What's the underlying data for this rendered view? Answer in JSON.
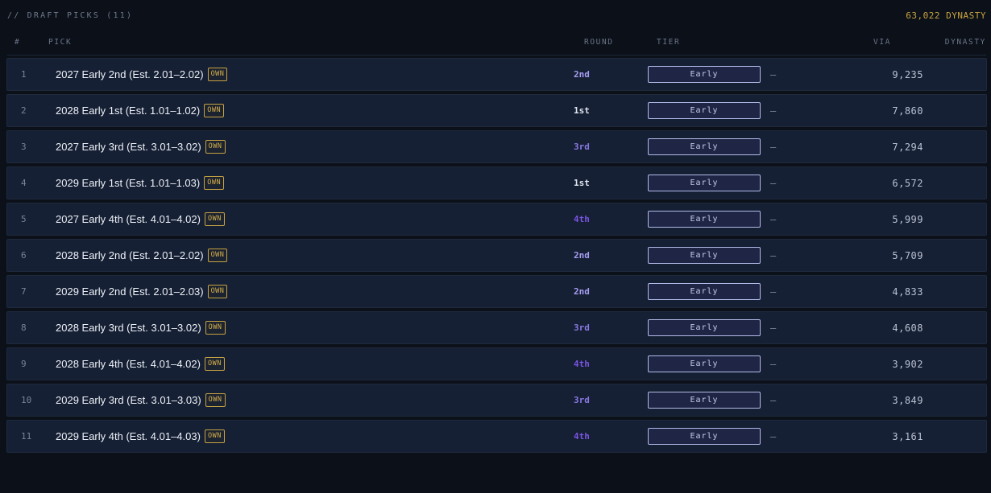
{
  "header": {
    "title": "// DRAFT PICKS (11)",
    "dynasty_total": "63,022 DYNASTY"
  },
  "columns": {
    "num": "#",
    "pick": "PICK",
    "round": "ROUND",
    "tier": "TIER",
    "via": "VIA",
    "dynasty": "DYNASTY"
  },
  "colors": {
    "round_1st": "#dfe3ee",
    "round_2nd": "#a79df2",
    "round_3rd": "#8a77e4",
    "round_4th": "#7a54e0",
    "own_badge": "#c6a243",
    "dynasty_total": "#c9a53f"
  },
  "picks": [
    {
      "num": "1",
      "name": "2027 Early 2nd (Est. 2.01–2.02)",
      "badge": "OWN",
      "round": "2nd",
      "tier": "Early",
      "via": "—",
      "dynasty": "9,235"
    },
    {
      "num": "2",
      "name": "2028 Early 1st (Est. 1.01–1.02)",
      "badge": "OWN",
      "round": "1st",
      "tier": "Early",
      "via": "—",
      "dynasty": "7,860"
    },
    {
      "num": "3",
      "name": "2027 Early 3rd (Est. 3.01–3.02)",
      "badge": "OWN",
      "round": "3rd",
      "tier": "Early",
      "via": "—",
      "dynasty": "7,294"
    },
    {
      "num": "4",
      "name": "2029 Early 1st (Est. 1.01–1.03)",
      "badge": "OWN",
      "round": "1st",
      "tier": "Early",
      "via": "—",
      "dynasty": "6,572"
    },
    {
      "num": "5",
      "name": "2027 Early 4th (Est. 4.01–4.02)",
      "badge": "OWN",
      "round": "4th",
      "tier": "Early",
      "via": "—",
      "dynasty": "5,999"
    },
    {
      "num": "6",
      "name": "2028 Early 2nd (Est. 2.01–2.02)",
      "badge": "OWN",
      "round": "2nd",
      "tier": "Early",
      "via": "—",
      "dynasty": "5,709"
    },
    {
      "num": "7",
      "name": "2029 Early 2nd (Est. 2.01–2.03)",
      "badge": "OWN",
      "round": "2nd",
      "tier": "Early",
      "via": "—",
      "dynasty": "4,833"
    },
    {
      "num": "8",
      "name": "2028 Early 3rd (Est. 3.01–3.02)",
      "badge": "OWN",
      "round": "3rd",
      "tier": "Early",
      "via": "—",
      "dynasty": "4,608"
    },
    {
      "num": "9",
      "name": "2028 Early 4th (Est. 4.01–4.02)",
      "badge": "OWN",
      "round": "4th",
      "tier": "Early",
      "via": "—",
      "dynasty": "3,902"
    },
    {
      "num": "10",
      "name": "2029 Early 3rd (Est. 3.01–3.03)",
      "badge": "OWN",
      "round": "3rd",
      "tier": "Early",
      "via": "—",
      "dynasty": "3,849"
    },
    {
      "num": "11",
      "name": "2029 Early 4th (Est. 4.01–4.03)",
      "badge": "OWN",
      "round": "4th",
      "tier": "Early",
      "via": "—",
      "dynasty": "3,161"
    }
  ]
}
